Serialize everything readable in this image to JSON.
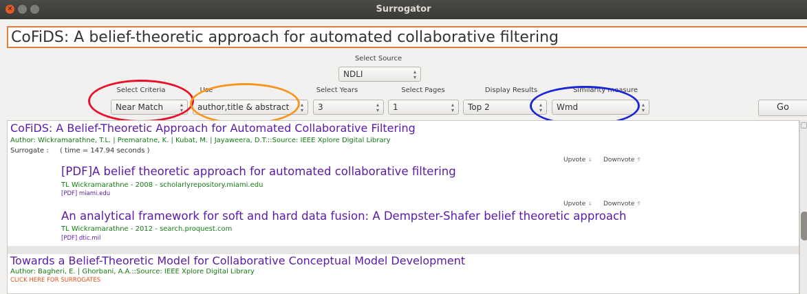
{
  "window": {
    "title": "Surrogator"
  },
  "query": {
    "value": "CoFiDS: A belief-theoretic approach for automated collaborative filtering"
  },
  "source": {
    "label": "Select Source",
    "value": "NDLI"
  },
  "criteria": {
    "label": "Select Criteria",
    "value": "Near Match"
  },
  "use": {
    "label": "Use",
    "value": "author,title & abstract"
  },
  "years": {
    "label": "Select Years",
    "value": "3"
  },
  "pages": {
    "label": "Select Pages",
    "value": "1"
  },
  "display": {
    "label": "Display Results",
    "value": "Top 2"
  },
  "similarity": {
    "label": "Similarity measure",
    "value": "Wmd"
  },
  "go_label": "Go",
  "results": [
    {
      "title": "CoFiDS: A Belief-Theoretic Approach for Automated Collaborative Filtering",
      "meta": "Author: Wickramarathne, T.L. | Premaratne, K. | Kubat, M. | Jayaweera, D.T.::Source: IEEE Xplore Digital Library",
      "surrogate_label": "Surrogate :",
      "surrogate_time": "( time = 147.94 seconds )",
      "surrogates": [
        {
          "upvote": "Upvote",
          "downvote": "Downvote",
          "title": "[PDF]A belief theoretic approach for automated collaborative filtering",
          "meta": "TL Wickramarathne - 2008 - scholarlyrepository.miami.edu",
          "link": "[PDF] miami.edu"
        },
        {
          "upvote": "Upvote",
          "downvote": "Downvote",
          "title": "An analytical framework for soft and hard data fusion: A Dempster-Shafer belief theoretic approach",
          "meta": "TL Wickramarathne - 2012 - search.proquest.com",
          "link": "[PDF] dtic.mil"
        }
      ]
    },
    {
      "title": "Towards a Belief-Theoretic Model for Collaborative Conceptual Model Development",
      "meta": "Author: Bagheri, E. | Ghorbani, A.A.::Source: IEEE Xplore Digital Library",
      "surrogates_link": "CLICK HERE FOR SURROGATES"
    }
  ],
  "annotation_colors": {
    "criteria": "#e8102a",
    "use": "#f7941d",
    "similarity": "#1a25d6"
  }
}
